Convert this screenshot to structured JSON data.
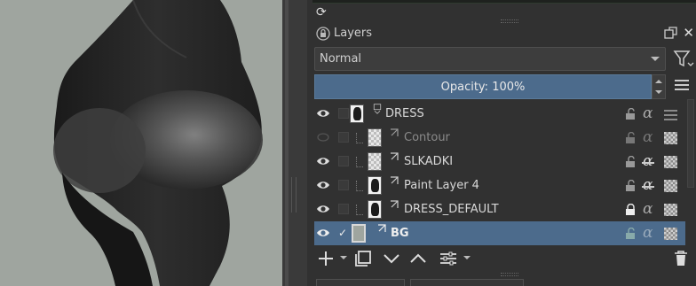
{
  "panel": {
    "title": "Layers",
    "blend_mode": "Normal",
    "opacity_label": "Opacity:  100%",
    "opacity_value": 100
  },
  "layers": [
    {
      "name": "DRESS",
      "visible": true,
      "selected": false,
      "thumb": "dark",
      "style": "normal",
      "checked": false
    },
    {
      "name": "Contour",
      "visible": false,
      "selected": false,
      "thumb": "checker",
      "style": "dim",
      "checked": false
    },
    {
      "name": "SLKADKI",
      "visible": true,
      "selected": false,
      "thumb": "checker",
      "style": "normal",
      "checked": false
    },
    {
      "name": "Paint Layer 4",
      "visible": true,
      "selected": false,
      "thumb": "dark",
      "style": "normal",
      "checked": false
    },
    {
      "name": "DRESS_DEFAULT",
      "visible": true,
      "selected": false,
      "thumb": "dark",
      "style": "normal",
      "checked": false
    },
    {
      "name": "BG",
      "visible": true,
      "selected": true,
      "thumb": "gray",
      "style": "bold",
      "checked": true
    }
  ],
  "icons": {
    "header": [
      "lock-icon",
      "float-icon",
      "close-icon"
    ],
    "toolbar": [
      "add-layer-icon",
      "duplicate-icon",
      "move-down-icon",
      "move-up-icon",
      "properties-icon",
      "delete-icon"
    ]
  },
  "colors": {
    "accent": "#4c6b8c",
    "canvas_bg": "#9fa59f",
    "panel_bg": "#313131"
  }
}
